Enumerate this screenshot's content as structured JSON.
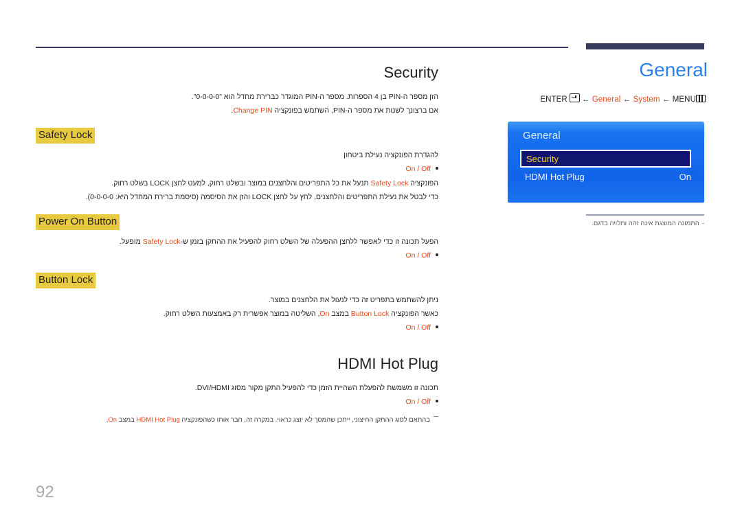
{
  "page": {
    "number": "92"
  },
  "chapter": {
    "title": "General",
    "breadcrumb": {
      "enter_label": "ENTER",
      "enter_icon": "enter-key-icon",
      "arrow": "←",
      "item_general": "General",
      "item_system": "System",
      "item_menu": "MENU",
      "menu_icon": "menu-grid-icon"
    }
  },
  "osd": {
    "title": "General",
    "items": [
      {
        "label": "Security",
        "value": "",
        "selected": true
      },
      {
        "label": "HDMI Hot Plug",
        "value": "On",
        "selected": false
      }
    ]
  },
  "panel_note": {
    "dash": "-",
    "text": "התמונה המוצגת אינה זהה ותלויה בדגם."
  },
  "content": {
    "security": {
      "title": "Security",
      "paragraphs": [
        {
          "pre": "הזן מספר ה-PIN בן 4 הספרות. מספר ה-PIN המוגדר כברירת מחדל הוא \"0-0-0-0\".",
          "hl": "",
          "post": ""
        },
        {
          "pre": "אם ברצונך לשנות את מספר ה-PIN, השתמש בפונקציה ",
          "hl": "Change PIN",
          "post": "."
        }
      ]
    },
    "safety_lock": {
      "title": "Safety Lock",
      "line1": "להגדרת הפונקציה נעילת ביטחון",
      "options": "On / Off",
      "line2_pre": "הפונקציה ",
      "line2_hl": "Safety Lock",
      "line2_post": " תנעל את כל התפריטים והלחצנים במוצר ובשלט רחוק, למעט לחצן LOCK בשלט רחוק.",
      "line3": "כדי לבטל את נעילת התפריטים והלחצנים, לחץ על לחצן LOCK והזן את הסיסמה (סיסמת ברירת המחדל היא: 0-0-0-0)."
    },
    "power_on_button": {
      "title": "Power On Button",
      "line1_pre": "הפעל תכונה זו כדי לאפשר ללחצן ההפעלה של השלט רחוק להפעיל את ההתקן בזמן ש-",
      "line1_hl": "Safety Lock",
      "line1_post": " מופעל.",
      "options": "On / Off"
    },
    "button_lock": {
      "title": "Button Lock",
      "line1": "ניתן להשתמש בתפריט זה כדי לנעול את הלחצנים במוצר.",
      "line2_pre": "כאשר הפונקציה ",
      "line2_hl1": "Button Lock",
      "line2_mid": " במצב ",
      "line2_hl2": "On",
      "line2_post": ", השליטה במוצר אפשרית רק באמצעות השלט רחוק.",
      "options": "On / Off"
    },
    "hdmi_hot_plug": {
      "title": "HDMI Hot Plug",
      "line1": "תכונה זו משמשת להפעלת השהיית הזמן כדי להפעיל התקן מקור מסוג DVI/HDMI.",
      "options": "On / Off",
      "footnote_pre": "בהתאם לסוג ההתקן החיצוני, ייתכן שהמסך לא יוצג כראוי. במקרה זה, חבר אותו כשהפונקציה ",
      "footnote_hl1": "HDMI Hot Plug",
      "footnote_mid": " במצב ",
      "footnote_hl2": "On",
      "footnote_post": "."
    }
  },
  "colors": {
    "accent_orange": "#e8491d",
    "chapter_blue": "#2d7fe8",
    "highlight_yellow": "#e8ca3f",
    "osd_blue": "#1873f0",
    "osd_selected_bg": "#101570",
    "osd_selected_text": "#ffd211",
    "rule_navy": "#383a5e",
    "page_gray": "#a7a9ac"
  }
}
